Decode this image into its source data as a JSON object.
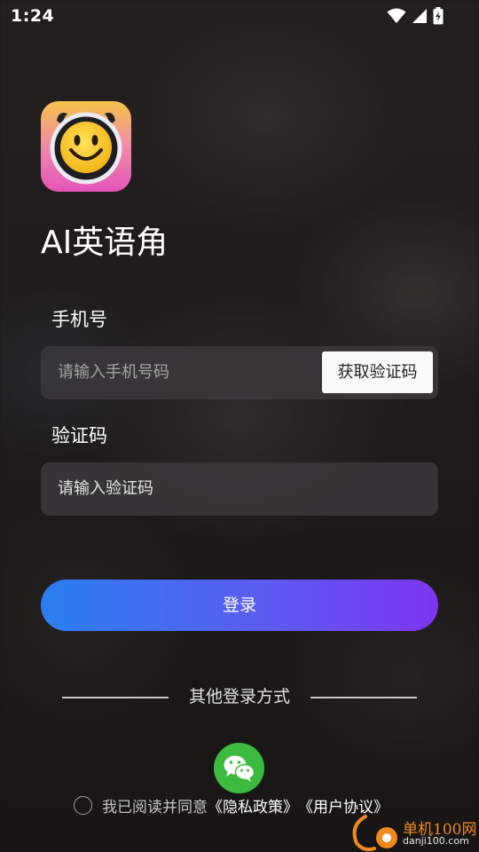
{
  "status_bar": {
    "time": "1:24",
    "icons": [
      "wifi-icon",
      "signal-icon",
      "battery-charging-icon"
    ]
  },
  "app": {
    "logo_icon": "smiley-devil-logo",
    "title": "AI英语角"
  },
  "phone": {
    "label": "手机号",
    "placeholder": "请输入手机号码",
    "get_code_label": "获取验证码"
  },
  "code": {
    "label": "验证码",
    "placeholder": "请输入验证码"
  },
  "login": {
    "label": "登录",
    "gradient": [
      "#2a7ef0",
      "#7c35ef"
    ]
  },
  "other_login": {
    "label": "其他登录方式",
    "options": [
      "wechat-icon"
    ],
    "wechat_color": "#3dbb3f"
  },
  "agreement": {
    "text": "我已阅读并同意",
    "privacy_link": "《隐私政策》",
    "user_link": "《用户协议》",
    "checked": false
  },
  "watermark": {
    "title": "单机100网",
    "url": "danji100.com"
  }
}
